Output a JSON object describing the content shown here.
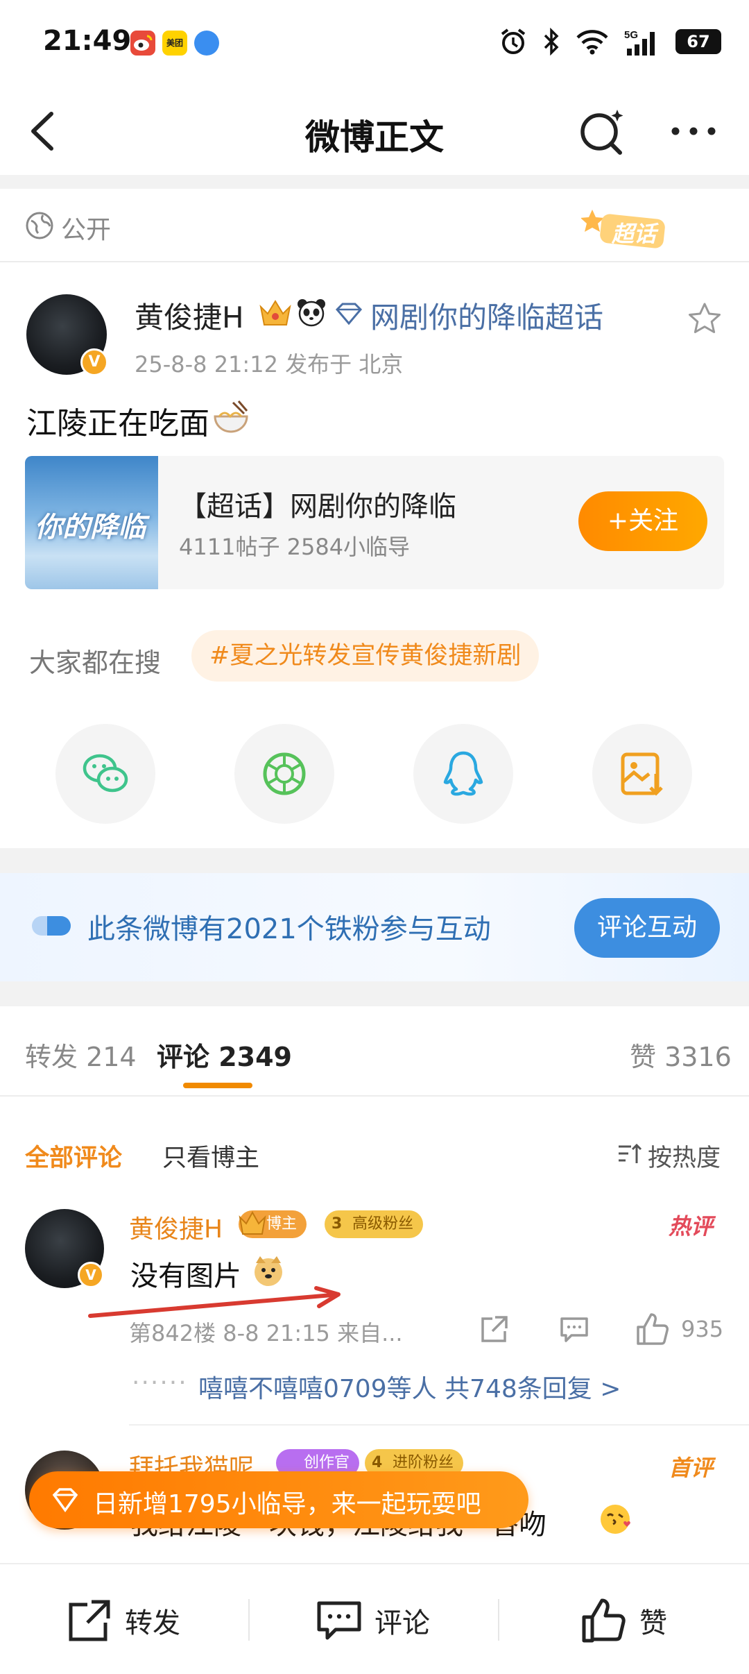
{
  "status_bar": {
    "time": "21:49",
    "battery": "67",
    "network": "5G",
    "app_icons": [
      "weibo-icon",
      "meituan-icon",
      "blue-app-icon"
    ],
    "meituan_label": "美团"
  },
  "header": {
    "title": "微博正文"
  },
  "visibility": {
    "label": "公开",
    "badge": "超话"
  },
  "post": {
    "author": "黄俊捷H",
    "topic": "网剧你的降临超话",
    "meta": "25-8-8 21:12   发布于 北京",
    "text": "江陵正在吃面",
    "avatar_badge": "V"
  },
  "topic_card": {
    "cover_text": "你的降临",
    "title": "【超话】网剧你的降临",
    "stats": "4111帖子 2584小临导",
    "follow_label": "+关注"
  },
  "search": {
    "label": "大家都在搜",
    "tag": "#夏之光转发宣传黄俊捷新剧"
  },
  "share_icons": [
    "wechat-icon",
    "moments-icon",
    "qq-icon",
    "save-image-icon"
  ],
  "fans_banner": {
    "text": "此条微博有2021个铁粉参与互动",
    "button": "评论互动"
  },
  "tabs": {
    "repost_label": "转发 214",
    "comment_label": "评论 2349",
    "like_label": "赞 3316"
  },
  "filter": {
    "all": "全部评论",
    "owner_only": "只看博主",
    "sort": "按热度"
  },
  "comments": [
    {
      "name": "黄俊捷H",
      "badge_1": "博主",
      "badge_2": "高级粉丝",
      "badge_2_level": "3",
      "label": "热评",
      "text": "没有图片",
      "meta": "第842楼  8-8 21:15  来自...",
      "likes": "935",
      "replies_dots": "······",
      "replies_link": "嘻嘻不嘻嘻0709等人  共748条回复 >"
    },
    {
      "name": "拜托我猫呢",
      "badge_1": "创作官",
      "badge_2": "进阶粉丝",
      "badge_2_level": "4",
      "label": "首评",
      "text": "我给江陵一块钱，江陵给我一香吻"
    }
  ],
  "promo": {
    "text": "日新增1795小临导，来一起玩耍吧"
  },
  "bottom_bar": {
    "repost": "转发",
    "comment": "评论",
    "like": "赞"
  },
  "colors": {
    "accent_orange": "#f08a1c",
    "link_blue": "#4a6fa5",
    "button_blue": "#3d8ee0",
    "hot_red": "#e34a5a"
  }
}
